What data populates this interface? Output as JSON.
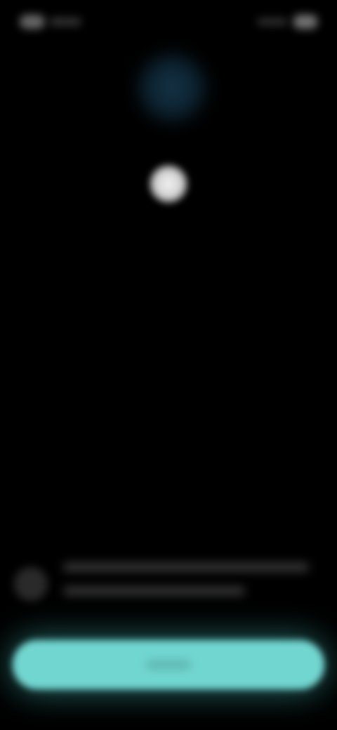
{
  "status_bar": {
    "time_icon": "status-time-icon",
    "signal_icon": "signal-icon",
    "battery_icon": "battery-icon"
  },
  "visual": {
    "glow_color": "#163447",
    "dot_color": "#f2f2f2"
  },
  "notice": {
    "icon": "info-icon",
    "line1": "",
    "line2": ""
  },
  "primary_button": {
    "label": "",
    "color": "#72d6d0"
  },
  "theme": {
    "background": "#000000",
    "accent": "#72d6d0"
  }
}
